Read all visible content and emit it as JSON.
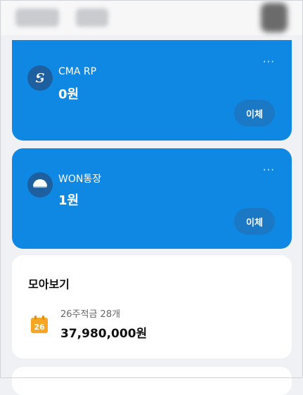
{
  "accounts": [
    {
      "name": "CMA RP",
      "balance": "0원",
      "action": "이체",
      "more": "···"
    },
    {
      "name": "WON통장",
      "balance": "1원",
      "action": "이체",
      "more": "···"
    }
  ],
  "summary": {
    "title": "모아보기",
    "item_label": "26주적금 28개",
    "item_amount": "37,980,000원",
    "calendar_day": "26"
  },
  "colors": {
    "card": "#0f88e4",
    "button": "#1b78c4",
    "calendar": "#f6a623"
  }
}
